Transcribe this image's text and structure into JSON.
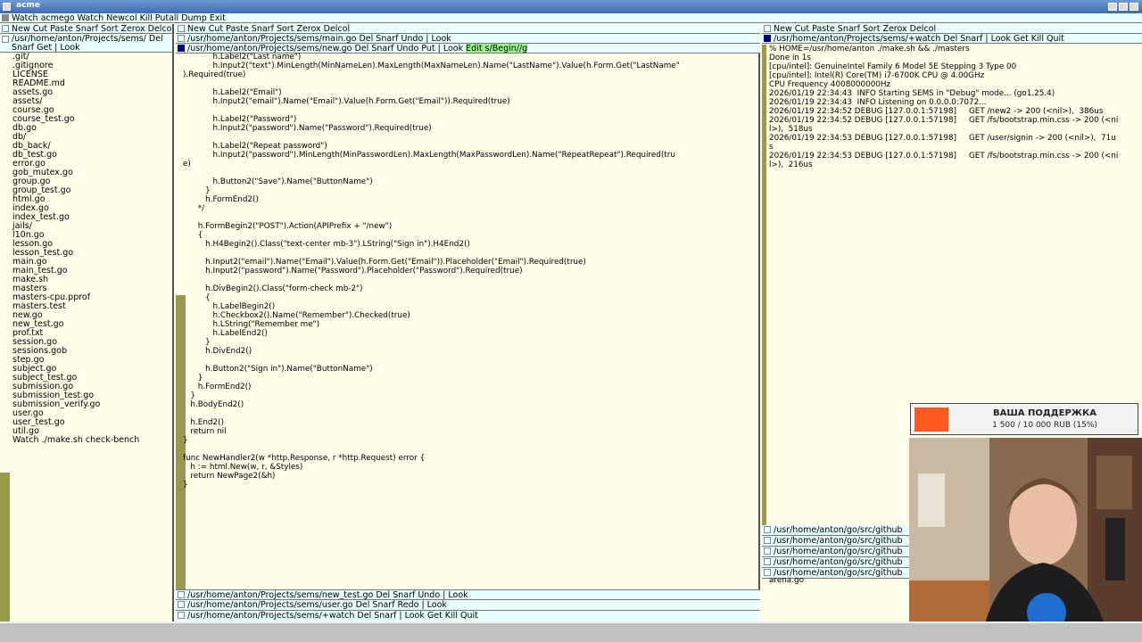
{
  "window": {
    "title": "acme"
  },
  "top_tag": "Watch acmego Watch Newcol Kill Putall Dump Exit",
  "left_col": {
    "col_tag": "New Cut Paste Snarf Sort Zerox Delcol",
    "win_tag": "/usr/home/anton/Projects/sems/ Del Snarf Get | Look",
    "files": [
      ".git/",
      ".gitignore",
      "LICENSE",
      "README.md",
      "assets.go",
      "assets/",
      "course.go",
      "course_test.go",
      "db.go",
      "db/",
      "db_back/",
      "db_test.go",
      "error.go",
      "gob_mutex.go",
      "group.go",
      "group_test.go",
      "html.go",
      "index.go",
      "index_test.go",
      "jails/",
      "l10n.go",
      "lesson.go",
      "lesson_test.go",
      "main.go",
      "main_test.go",
      "make.sh",
      "masters",
      "masters-cpu.pprof",
      "masters.test",
      "new.go",
      "new_test.go",
      "prof.txt",
      "session.go",
      "sessions.gob",
      "step.go",
      "subject.go",
      "subject_test.go",
      "submission.go",
      "submission_test.go",
      "submission_verify.go",
      "user.go",
      "user_test.go",
      "util.go",
      "Watch ./make.sh check-bench"
    ]
  },
  "mid_col": {
    "col_tag": "New Cut Paste Snarf Sort Zerox Delcol",
    "tag_main": "/usr/home/anton/Projects/sems/main.go Del Snarf Undo | Look",
    "tag_new": "/usr/home/anton/Projects/sems/new.go Del Snarf Undo Put | Look",
    "tag_new_sel": "Edit s/Begin//g",
    "code_lines": [
      "            h.Label2(\"Last name\")",
      "            h.Input2(\"text\").MinLength(MinNameLen).MaxLength(MaxNameLen).Name(\"LastName\").Value(h.Form.Get(\"LastName\"",
      ").Required(true)",
      "",
      "            h.Label2(\"Email\")",
      "            h.Input2(\"email\").Name(\"Email\").Value(h.Form.Get(\"Email\")).Required(true)",
      "",
      "            h.Label2(\"Password\")",
      "            h.Input2(\"password\").Name(\"Password\").Required(true)",
      "",
      "            h.Label2(\"Repeat password\")",
      "            h.Input2(\"password\").MinLength(MinPasswordLen).MaxLength(MaxPasswordLen).Name(\"RepeatRepeat\").Required(tru",
      "e)",
      "",
      "            h.Button2(\"Save\").Name(\"ButtonName\")",
      "         }",
      "         h.FormEnd2()",
      "      */",
      "",
      "      h.FormBegin2(\"POST\").Action(APIPrefix + \"/new\")",
      "      {",
      "         h.H4Begin2().Class(\"text-center mb-3\").LString(\"Sign in\").H4End2()",
      "",
      "         h.Input2(\"email\").Name(\"Email\").Value(h.Form.Get(\"Email\")).Placeholder(\"Email\").Required(true)",
      "         h.Input2(\"password\").Name(\"Password\").Placeholder(\"Password\").Required(true)",
      "",
      "         h.DivBegin2().Class(\"form-check mb-2\")",
      "         {",
      "            h.LabelBegin2()",
      "            h.Checkbox2().Name(\"Remember\").Checked(true)",
      "            h.LString(\"Remember me\")",
      "            h.LabelEnd2()",
      "         }",
      "         h.DivEnd2()",
      "",
      "         h.Button2(\"Sign in\").Name(\"ButtonName\")",
      "      }",
      "      h.FormEnd2()",
      "   }",
      "   h.BodyEnd2()",
      "",
      "   h.End2()",
      "   return nil",
      "}",
      "",
      "func NewHandler2(w *http.Response, r *http.Request) error {",
      "   h := html.New(w, r, &Styles)",
      "   return NewPage2(&h)",
      "}"
    ],
    "tag_new_test": "/usr/home/anton/Projects/sems/new_test.go Del Snarf Undo | Look",
    "tag_user": "/usr/home/anton/Projects/sems/user.go Del Snarf Redo | Look",
    "tag_watch": "/usr/home/anton/Projects/sems/+watch Del Snarf | Look Get Kill Quit"
  },
  "right_col": {
    "col_tag": "New Cut Paste Snarf Sort Zerox Delcol",
    "win_tag": "/usr/home/anton/Projects/sems/+watch Del Snarf | Look Get Kill Quit",
    "output_lines": [
      "% HOME=/usr/home/anton ./make.sh && ./masters",
      "Done in 1s",
      "[cpu/intel]: GenuineIntel Family 6 Model 5E Stepping 3 Type 00",
      "[cpu/intel]: Intel(R) Core(TM) i7-6700K CPU @ 4.00GHz",
      "CPU Frequency 4008000000Hz",
      "2026/01/19 22:34:43  INFO Starting SEMS in \"Debug\" mode... (go1.25.4)",
      "2026/01/19 22:34:43  INFO Listening on 0.0.0.0:7072...",
      "2026/01/19 22:34:52 DEBUG [127.0.0.1:57198]     GET /new2 -> 200 (<nil>),  386us",
      "2026/01/19 22:34:52 DEBUG [127.0.0.1:57198]     GET /fs/bootstrap.min.css -> 200 (<ni",
      "l>),  518us",
      "2026/01/19 22:34:53 DEBUG [127.0.0.1:57198]     GET /user/signin -> 200 (<nil>),  71u",
      "s",
      "2026/01/19 22:34:53 DEBUG [127.0.0.1:57198]     GET /fs/bootstrap.min.css -> 200 (<ni",
      "l>),  216us"
    ],
    "stack_tags": [
      "/usr/home/anton/go/src/github",
      "/usr/home/anton/go/src/github",
      "/usr/home/anton/go/src/github",
      "/usr/home/anton/go/src/github",
      "/usr/home/anton/go/src/github"
    ],
    "bottom_text": "arena.go"
  },
  "overlay": {
    "title": "ВАША ПОДДЕРЖКА",
    "amount": "1 500 / 10 000 RUB (15%)",
    "progress": 0.15,
    "accent": "#ff5a1f"
  }
}
